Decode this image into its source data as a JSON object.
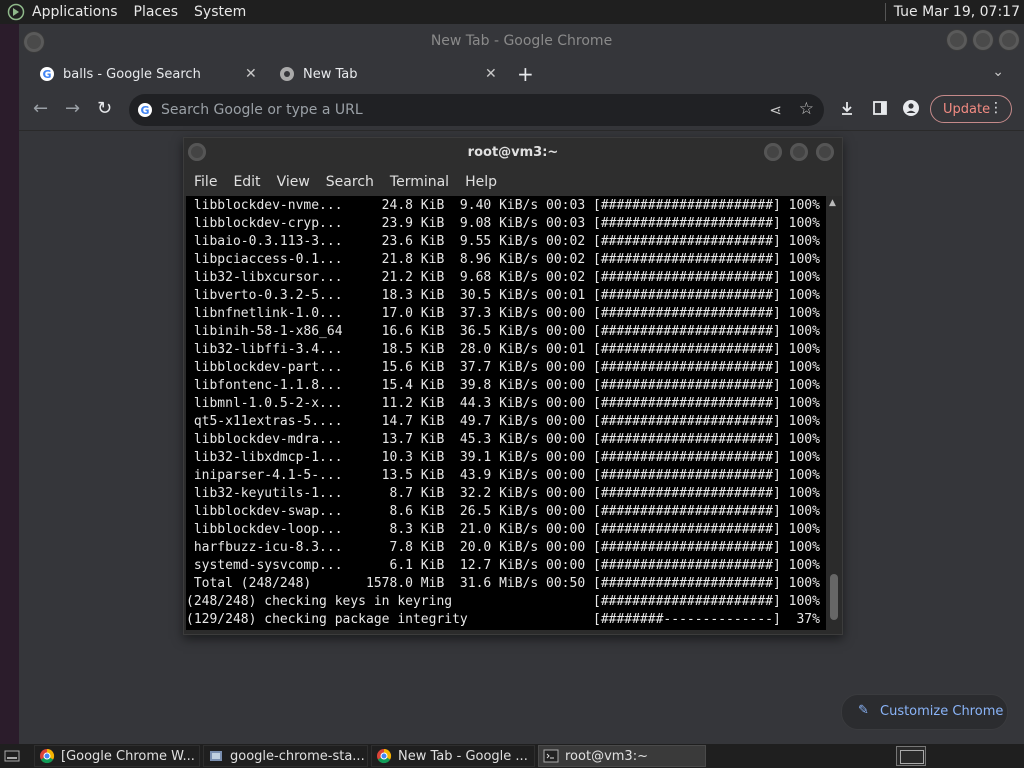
{
  "top_panel": {
    "menus": [
      "Applications",
      "Places",
      "System"
    ],
    "clock": "Tue Mar 19, 07:17"
  },
  "chrome": {
    "window_title": "New Tab - Google Chrome",
    "tabs": [
      {
        "label": "balls - Google Search"
      },
      {
        "label": "New Tab"
      }
    ],
    "omnibox_placeholder": "Search Google or type a URL",
    "update_label": "Update",
    "customize_label": "Customize Chrome"
  },
  "terminal": {
    "title": "root@vm3:~",
    "menu": [
      "File",
      "Edit",
      "View",
      "Search",
      "Terminal",
      "Help"
    ],
    "lines": [
      " libblockdev-nvme...     24.8 KiB  9.40 KiB/s 00:03 [######################] 100%",
      " libblockdev-cryp...     23.9 KiB  9.08 KiB/s 00:03 [######################] 100%",
      " libaio-0.3.113-3...     23.6 KiB  9.55 KiB/s 00:02 [######################] 100%",
      " libpciaccess-0.1...     21.8 KiB  8.96 KiB/s 00:02 [######################] 100%",
      " lib32-libxcursor...     21.2 KiB  9.68 KiB/s 00:02 [######################] 100%",
      " libverto-0.3.2-5...     18.3 KiB  30.5 KiB/s 00:01 [######################] 100%",
      " libnfnetlink-1.0...     17.0 KiB  37.3 KiB/s 00:00 [######################] 100%",
      " libinih-58-1-x86_64     16.6 KiB  36.5 KiB/s 00:00 [######################] 100%",
      " lib32-libffi-3.4...     18.5 KiB  28.0 KiB/s 00:01 [######################] 100%",
      " libblockdev-part...     15.6 KiB  37.7 KiB/s 00:00 [######################] 100%",
      " libfontenc-1.1.8...     15.4 KiB  39.8 KiB/s 00:00 [######################] 100%",
      " libmnl-1.0.5-2-x...     11.2 KiB  44.3 KiB/s 00:00 [######################] 100%",
      " qt5-x11extras-5....     14.7 KiB  49.7 KiB/s 00:00 [######################] 100%",
      " libblockdev-mdra...     13.7 KiB  45.3 KiB/s 00:00 [######################] 100%",
      " lib32-libxdmcp-1...     10.3 KiB  39.1 KiB/s 00:00 [######################] 100%",
      " iniparser-4.1-5-...     13.5 KiB  43.9 KiB/s 00:00 [######################] 100%",
      " lib32-keyutils-1...      8.7 KiB  32.2 KiB/s 00:00 [######################] 100%",
      " libblockdev-swap...      8.6 KiB  26.5 KiB/s 00:00 [######################] 100%",
      " libblockdev-loop...      8.3 KiB  21.0 KiB/s 00:00 [######################] 100%",
      " harfbuzz-icu-8.3...      7.8 KiB  20.0 KiB/s 00:00 [######################] 100%",
      " systemd-sysvcomp...      6.1 KiB  12.7 KiB/s 00:00 [######################] 100%",
      " Total (248/248)       1578.0 MiB  31.6 MiB/s 00:50 [######################] 100%",
      "(248/248) checking keys in keyring                  [######################] 100%",
      "(129/248) checking package integrity                [########--------------]  37%"
    ]
  },
  "taskbar": {
    "items": [
      {
        "label": "[Google Chrome W..."
      },
      {
        "label": "google-chrome-sta..."
      },
      {
        "label": "New Tab - Google ..."
      },
      {
        "label": "root@vm3:~"
      }
    ]
  }
}
